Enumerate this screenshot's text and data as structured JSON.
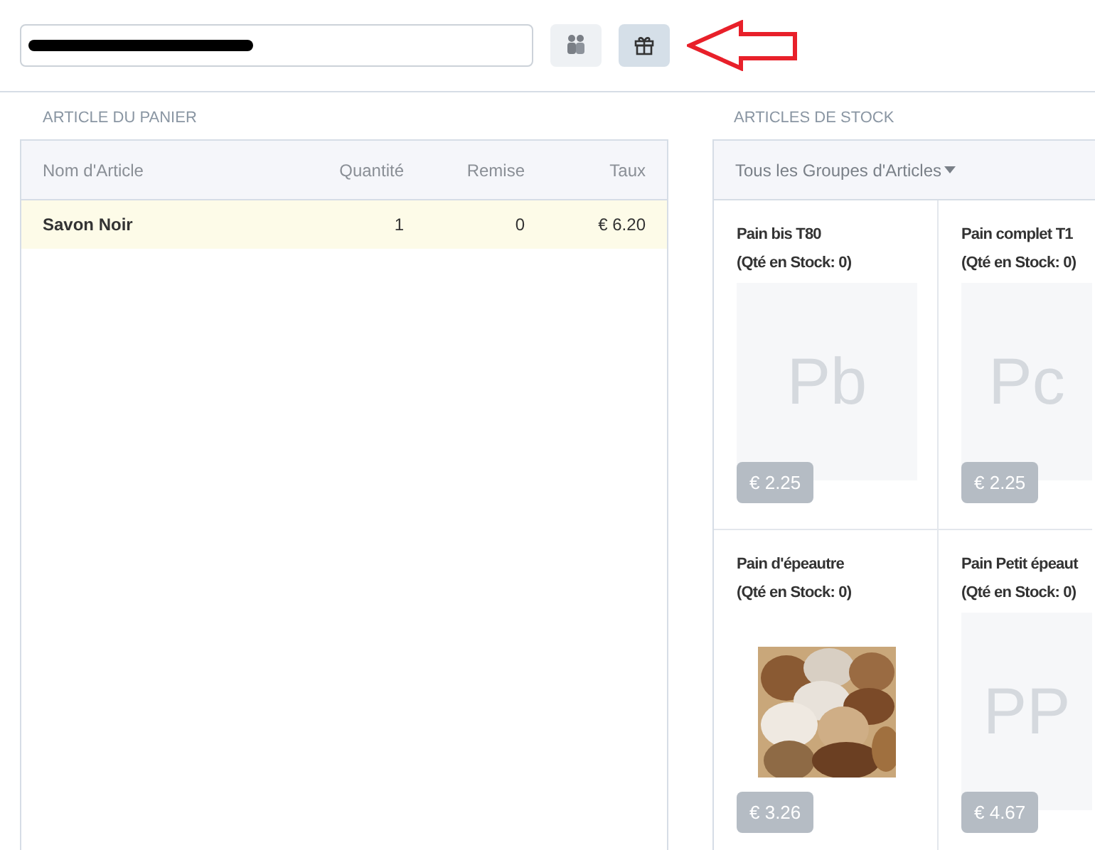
{
  "toolbar": {
    "buttons": [
      {
        "kind": "group",
        "selected": false
      },
      {
        "kind": "gift",
        "selected": true
      }
    ]
  },
  "cart": {
    "title": "ARTICLE DU PANIER",
    "columns": [
      "Nom d'Article",
      "Quantité",
      "Remise",
      "Taux"
    ],
    "rows": [
      {
        "name": "Savon Noir",
        "quantity": "1",
        "discount": "0",
        "rate": "€ 6.20",
        "selected": true
      }
    ]
  },
  "stock": {
    "title": "ARTICLES DE STOCK",
    "filter": "Tous les Groupes d'Articles",
    "items": [
      {
        "name": "Pain bis T80",
        "stock": "(Qté en Stock: 0)",
        "kind": "initials",
        "initials": "Pb",
        "price": "€ 2.25"
      },
      {
        "name": "Pain complet T1",
        "stock": "(Qté en Stock: 0)",
        "kind": "initials",
        "initials": "Pc",
        "price": "€ 2.25"
      },
      {
        "name": "Pain d'épeautre",
        "stock": "(Qté en Stock: 0)",
        "kind": "picture",
        "price": "€ 3.26"
      },
      {
        "name": "Pain Petit épeaut",
        "stock": "(Qté en Stock: 0)",
        "kind": "initials",
        "initials": "PP",
        "price": "€ 4.67"
      }
    ]
  }
}
